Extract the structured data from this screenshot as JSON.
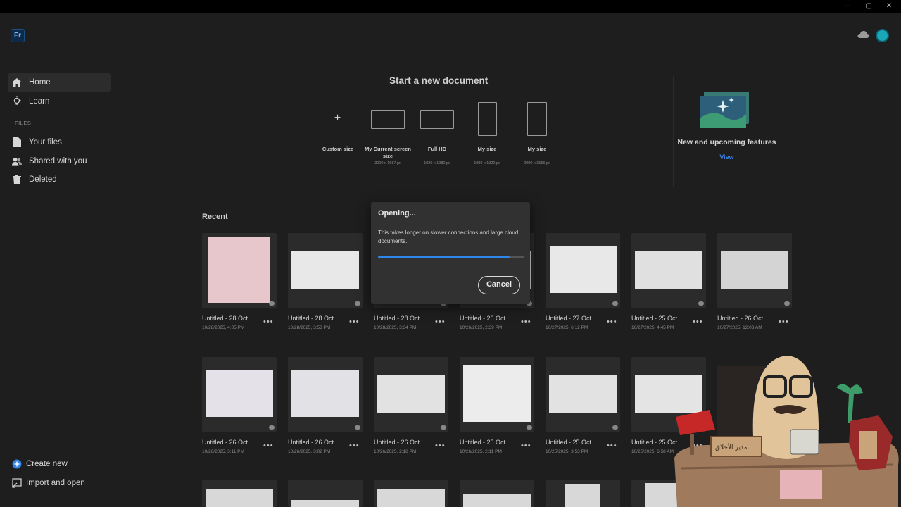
{
  "app": {
    "logo": "Fr"
  },
  "window": {
    "minimize": "–",
    "maximize": "▢",
    "close": "✕"
  },
  "header": {
    "cloud_icon": "cloud-icon",
    "avatar": "avatar"
  },
  "sidebar": {
    "items": [
      {
        "label": "Home",
        "icon": "home-icon"
      },
      {
        "label": "Learn",
        "icon": "lightbulb-icon"
      }
    ],
    "section_label": "FILES",
    "file_items": [
      {
        "label": "Your files",
        "icon": "file-icon"
      },
      {
        "label": "Shared with you",
        "icon": "people-icon"
      },
      {
        "label": "Deleted",
        "icon": "trash-icon"
      }
    ],
    "bottom": [
      {
        "label": "Create new",
        "icon": "plus-circle-icon"
      },
      {
        "label": "Import and open",
        "icon": "import-icon"
      }
    ]
  },
  "new_doc": {
    "title": "Start a new document",
    "templates": [
      {
        "label": "Custom size",
        "sub": ""
      },
      {
        "label": "My Current screen size",
        "sub": "3000 x 1687 px"
      },
      {
        "label": "Full HD",
        "sub": "1920 x 1080 px"
      },
      {
        "label": "My size",
        "sub": "1080 x 1920 px"
      },
      {
        "label": "My size",
        "sub": "2000 x 3556 px"
      }
    ]
  },
  "features": {
    "title": "New and upcoming features",
    "link": "View"
  },
  "recent": {
    "title": "Recent",
    "row1": [
      {
        "title": "Untitled - 28 Oct...",
        "date": "10/28/2025, 4:05 PM"
      },
      {
        "title": "Untitled - 28 Oct...",
        "date": "10/28/2025, 3:53 PM"
      },
      {
        "title": "Untitled - 28 Oct...",
        "date": "10/28/2025, 3:34 PM"
      },
      {
        "title": "Untitled - 26 Oct...",
        "date": "10/26/2025, 2:39 PM"
      },
      {
        "title": "Untitled - 27 Oct...",
        "date": "10/27/2025, 6:12 PM"
      },
      {
        "title": "Untitled - 25 Oct...",
        "date": "10/27/2025, 4:45 PM"
      },
      {
        "title": "Untitled - 26 Oct...",
        "date": "10/27/2025, 12:03 AM"
      }
    ],
    "row2": [
      {
        "title": "Untitled - 26 Oct...",
        "date": "10/26/2025, 3:11 PM"
      },
      {
        "title": "Untitled - 26 Oct...",
        "date": "10/26/2025, 3:02 PM"
      },
      {
        "title": "Untitled - 26 Oct...",
        "date": "10/26/2025, 2:18 PM"
      },
      {
        "title": "Untitled - 25 Oct...",
        "date": "10/26/2025, 2:11 PM"
      },
      {
        "title": "Untitled - 25 Oct...",
        "date": "10/25/2025, 3:53 PM"
      },
      {
        "title": "Untitled - 25 Oct...",
        "date": "10/25/2025, 6:58 AM"
      }
    ],
    "more": "•••"
  },
  "dialog": {
    "title": "Opening...",
    "message": "This takes longer on slower connections and large cloud documents.",
    "progress": 0.9,
    "cancel": "Cancel"
  },
  "sticker": {
    "sign_text": "مدير الأخلاق"
  },
  "colors": {
    "accent": "#2f86ea",
    "link": "#3b7fe0",
    "background": "#1e1e1e"
  }
}
